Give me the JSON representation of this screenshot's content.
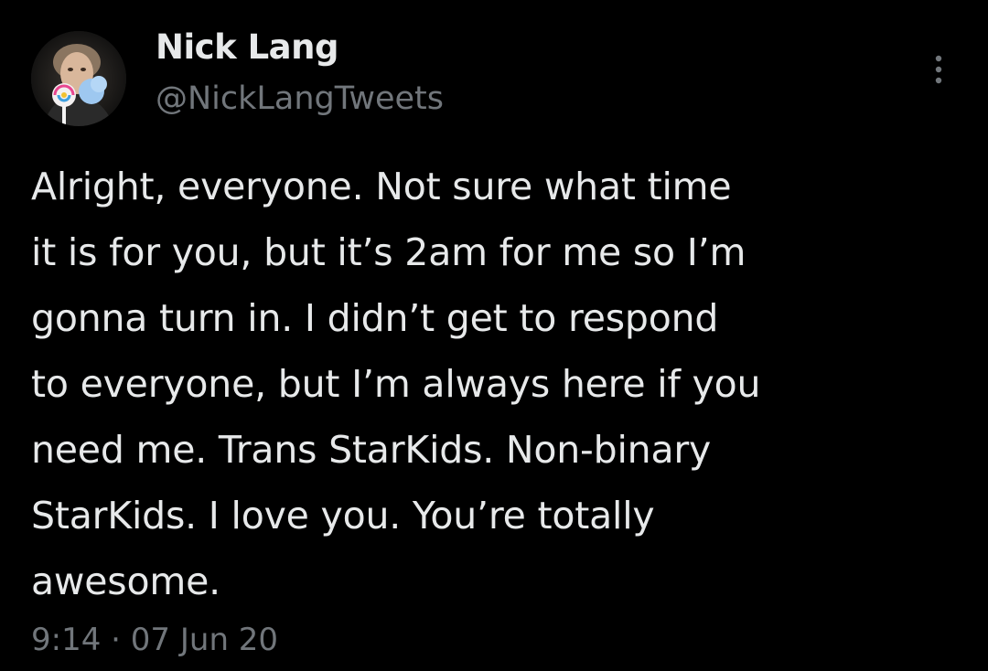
{
  "author": {
    "name": "Nick Lang",
    "handle": "@NickLangTweets"
  },
  "tweet": {
    "text": "Alright, everyone. Not sure what time\nit is for you, but it’s 2am for me so I’m\ngonna turn in. I didn’t get to respond\nto everyone, but I’m always here if you\nneed me. Trans StarKids. Non-binary\nStarKids. I love you. You’re totally\nawesome.",
    "time": "9:14",
    "separator": "·",
    "date": "07 Jun 20"
  },
  "icons": {
    "more": "more-vertical-icon",
    "avatar": "avatar"
  },
  "colors": {
    "background": "#000000",
    "primary_text": "#e7e9ea",
    "secondary_text": "#71767b"
  }
}
